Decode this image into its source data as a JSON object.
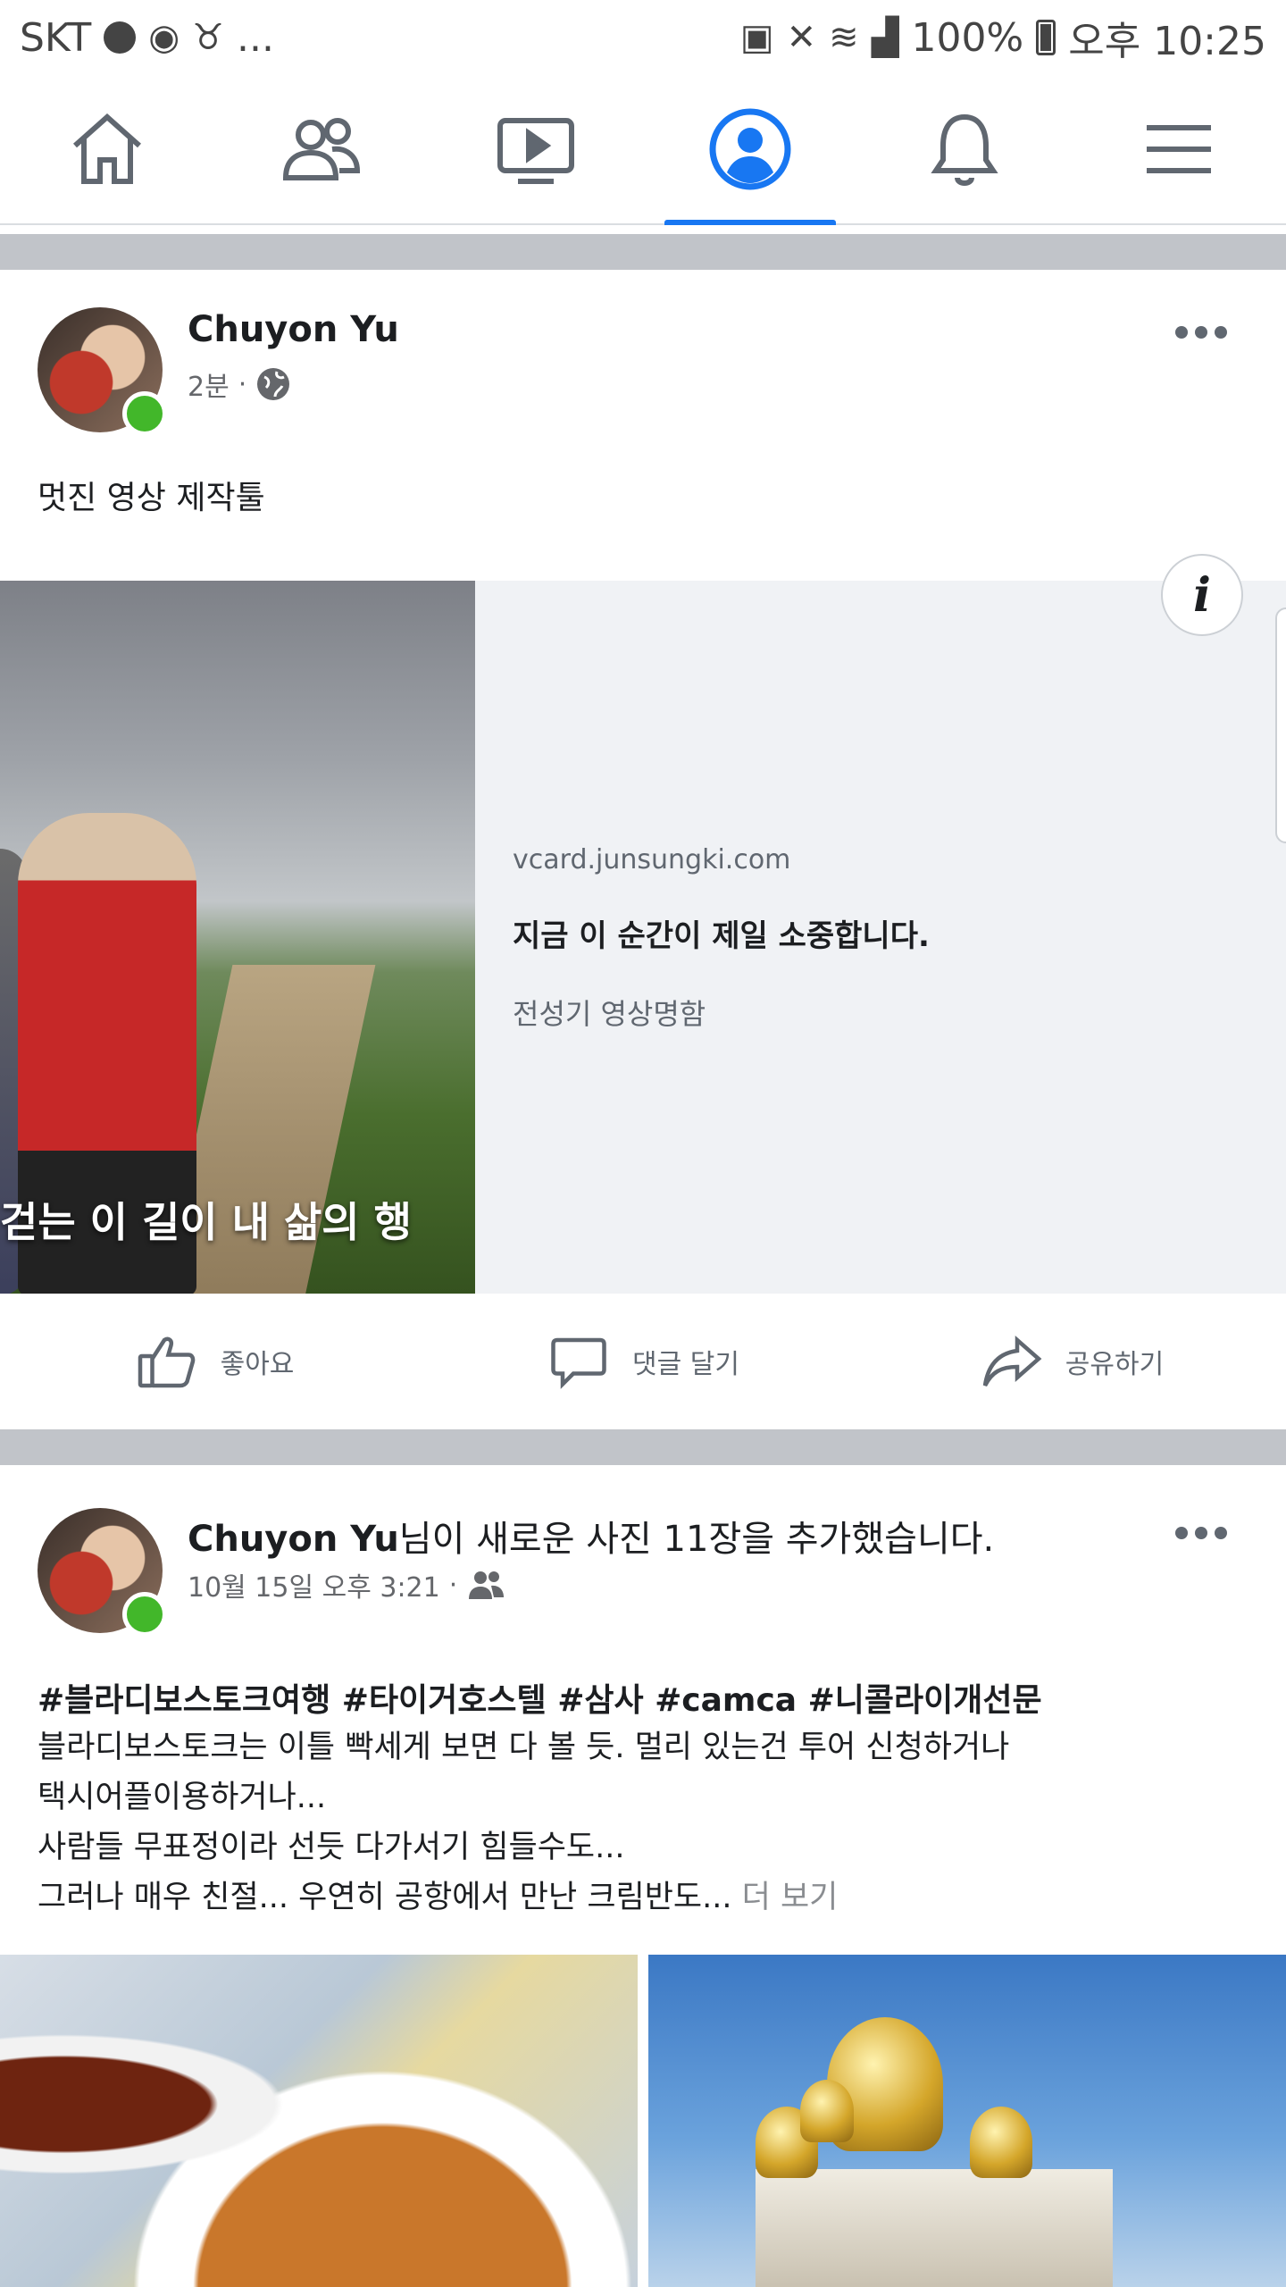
{
  "status_bar": {
    "carrier": "SKT",
    "extra": "...",
    "battery": "100%",
    "time": "오후 10:25"
  },
  "nav": {
    "items": [
      {
        "name": "home",
        "icon": "home-icon"
      },
      {
        "name": "friends",
        "icon": "friends-icon"
      },
      {
        "name": "watch",
        "icon": "video-icon"
      },
      {
        "name": "profile",
        "icon": "profile-icon",
        "active": true
      },
      {
        "name": "notifications",
        "icon": "bell-icon"
      },
      {
        "name": "menu",
        "icon": "hamburger-menu-icon"
      }
    ],
    "accent": "#1877f2"
  },
  "post1": {
    "author": "Chuyon Yu",
    "time": "2분",
    "sep": "·",
    "audience_icon": "globe-icon",
    "text": "멋진 영상 제작툴",
    "link": {
      "image_caption": "걷는 이 길이 내 삶의 행",
      "domain": "vcard.junsungki.com",
      "title": "지금 이 순간이 제일 소중합니다.",
      "description": "전성기 영상명함",
      "info_label": "i"
    }
  },
  "actions": {
    "like": "좋아요",
    "comment": "댓글 달기",
    "share": "공유하기"
  },
  "post2": {
    "author": "Chuyon Yu",
    "headline_suffix": "님이 새로운 사진 11장을 추가했습니다.",
    "time": "10월 15일 오후 3:21",
    "sep": "·",
    "audience_icon": "friends-icon",
    "hashtags": "#블라디보스토크여행 #타이거호스텔 #삼사 #camca #니콜라이개선문",
    "lines": [
      "블라디보스토크는 이틀 빡세게 보면 다 볼 듯. 멀리 있는건 투어 신청하거나",
      "택시어플이용하거나...",
      "사람들 무표정이라 선듯 다가서기 힘들수도...",
      "그러나 매우 친절... 우연히 공항에서 만난 크림반도..."
    ],
    "see_more": "더 보기"
  },
  "colors": {
    "divider": "#c1c4c9",
    "online": "#42b72a",
    "muted_text": "#65676b"
  }
}
